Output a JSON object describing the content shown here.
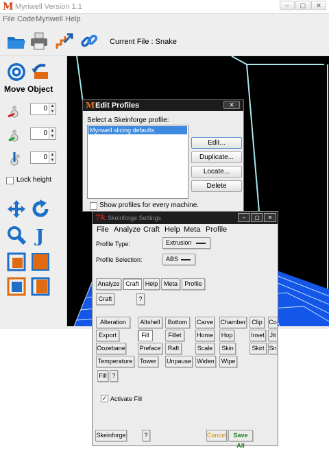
{
  "main": {
    "title": "Myriwell Version 1.1",
    "menu": [
      "File",
      "Code",
      "Myriwell",
      "Help"
    ],
    "current_file_label": "Current File : Snake",
    "move_object_label": "Move Object",
    "spinners": [
      "0",
      "0",
      "0"
    ],
    "lock_height_label": "Lock height"
  },
  "edit_profiles": {
    "title": "Edit Profiles",
    "select_label": "Select a Skeinforge profile:",
    "selected_profile": "Myriwell slicing defaults",
    "buttons": [
      "Edit...",
      "Duplicate...",
      "Locate...",
      "Delete"
    ],
    "show_all_label": "Show profiles for every machine.",
    "close_glyph": "✕"
  },
  "skeinforge": {
    "title": "Skeinforge Settings",
    "menu": [
      "File",
      "Analyze",
      "Craft",
      "Help",
      "Meta",
      "Profile"
    ],
    "profile_type_label": "Profile Type:",
    "profile_type_value": "Extrusion",
    "profile_selection_label": "Profile Selection:",
    "profile_selection_value": "ABS",
    "tabs": [
      "Analyze",
      "Craft",
      "Help",
      "Meta",
      "Profile"
    ],
    "craft_label": "Craft",
    "help_q": "?",
    "plugins": [
      [
        "Alteration",
        "Altshell",
        "Bottom",
        "Carve",
        "Chamber",
        "Clip",
        "Co"
      ],
      [
        "Export",
        "Fill",
        "Fillet",
        "Home",
        "Hop",
        "Inset",
        "Jit"
      ],
      [
        "Oozebane",
        "Preface",
        "Raft",
        "Scale",
        "Skin",
        "Skirt",
        "Sn"
      ],
      [
        "Temperature",
        "Tower",
        "Unpause",
        "Widen",
        "Wipe"
      ]
    ],
    "fill_label": "Fill",
    "activate_fill_label": "Activate Fill",
    "footer": {
      "skeinforge": "Skeinforge",
      "cancel": "Cancel",
      "save_all": "Save All"
    },
    "colors": {
      "cancel": "#e08a00",
      "save_all": "#1a7a1a"
    }
  }
}
